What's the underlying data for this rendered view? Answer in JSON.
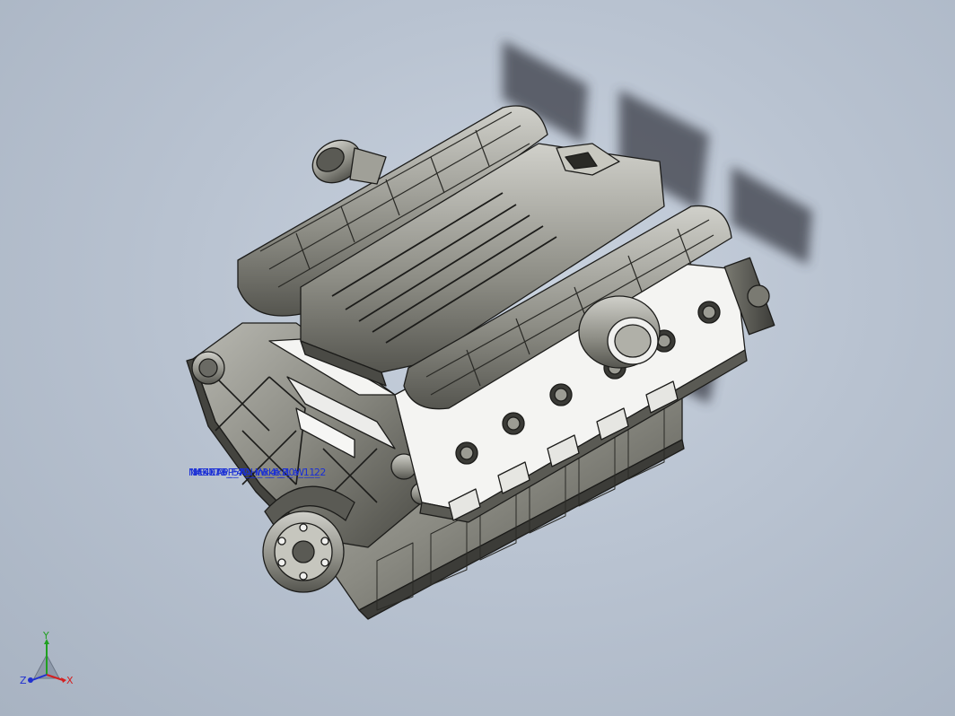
{
  "viewport": {
    "background": "#b9c3d1",
    "model_colors": {
      "body": "#8e8e86",
      "body_dark": "#4a4a45",
      "edge": "#1c1c1a",
      "white_part": "#f4f4f2",
      "shadow": "#3b3f47"
    }
  },
  "annotations": [
    "NAE7T8_F4D_lnk_e_1",
    "MKNT6P_7A_W_4k2_e_1_2",
    "NE4EAP_5A_H_3kf_B0W_1_2"
  ],
  "triad": {
    "x_label": "X",
    "y_label": "Y",
    "z_label": "Z",
    "x_color": "#d42020",
    "y_color": "#20a020",
    "z_color": "#2030d0"
  }
}
